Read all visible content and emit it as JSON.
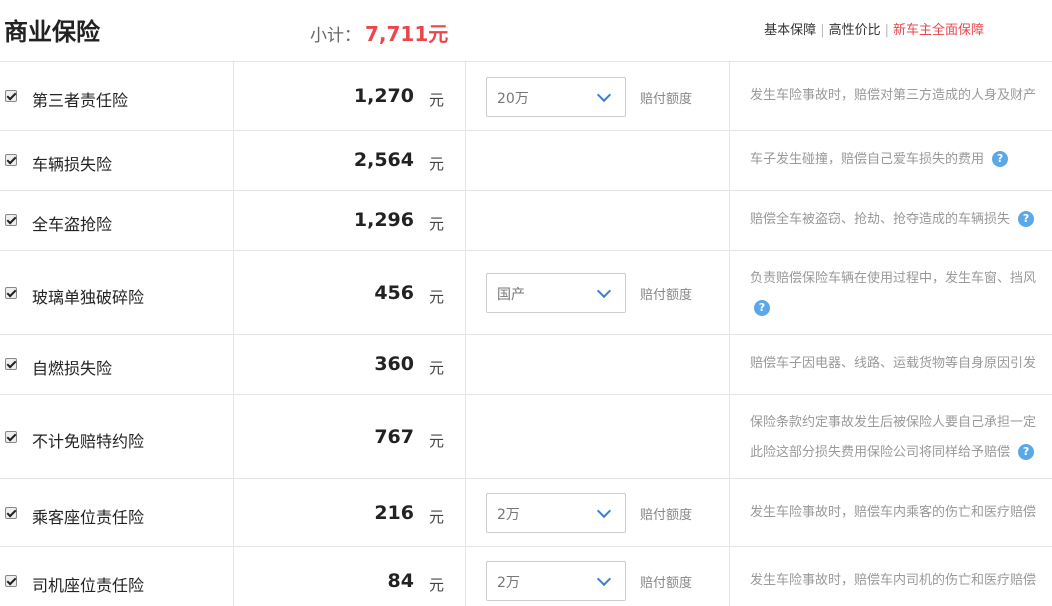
{
  "header": {
    "title": "商业保险",
    "subtotal_label": "小计：",
    "subtotal_amount": "7,711元",
    "plans": [
      "基本保障",
      "高性价比",
      "新车主全面保障"
    ],
    "colors": {
      "accent_red": "#e8474c",
      "question_blue": "#5aa8e8"
    }
  },
  "rows": [
    {
      "name": "第三者责任险",
      "price": "1,270",
      "unit": "元",
      "select": "20万",
      "hint": "赔付额度",
      "desc1": "发生车险事故时，赔偿对第三方造成的人身及财产",
      "desc2": ""
    },
    {
      "name": "车辆损失险",
      "price": "2,564",
      "unit": "元",
      "select": "",
      "hint": "",
      "desc1": "车子发生碰撞，赔偿自己爱车损失的费用",
      "desc2": ""
    },
    {
      "name": "全车盗抢险",
      "price": "1,296",
      "unit": "元",
      "select": "",
      "hint": "",
      "desc1": "赔偿全车被盗窃、抢劫、抢夺造成的车辆损失",
      "desc2": ""
    },
    {
      "name": "玻璃单独破碎险",
      "price": "456",
      "unit": "元",
      "select": "国产",
      "hint": "赔付额度",
      "desc1": "负责赔偿保险车辆在使用过程中，发生车窗、挡风",
      "desc2": ""
    },
    {
      "name": "自燃损失险",
      "price": "360",
      "unit": "元",
      "select": "",
      "hint": "",
      "desc1": "赔偿车子因电器、线路、运载货物等自身原因引发",
      "desc2": ""
    },
    {
      "name": "不计免赔特约险",
      "price": "767",
      "unit": "元",
      "select": "",
      "hint": "",
      "desc1": "保险条款约定事故发生后被保险人要自己承担一定",
      "desc2": "此险这部分损失费用保险公司将同样给予赔偿"
    },
    {
      "name": "乘客座位责任险",
      "price": "216",
      "unit": "元",
      "select": "2万",
      "hint": "赔付额度",
      "desc1": "发生车险事故时，赔偿车内乘客的伤亡和医疗赔偿",
      "desc2": ""
    },
    {
      "name": "司机座位责任险",
      "price": "84",
      "unit": "元",
      "select": "2万",
      "hint": "赔付额度",
      "desc1": "发生车险事故时，赔偿车内司机的伤亡和医疗赔偿",
      "desc2": ""
    }
  ]
}
